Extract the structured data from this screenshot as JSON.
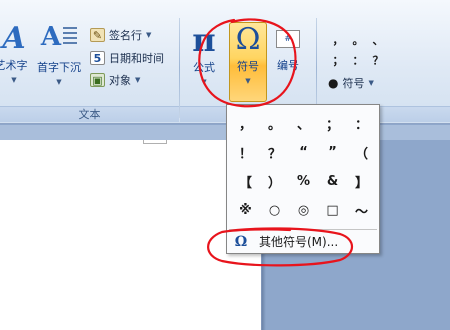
{
  "ribbon": {
    "text_group": {
      "label": "文本",
      "wordart_label": "艺术字",
      "dropcap_label": "首字下沉",
      "signature_label": "签名行",
      "datetime_label": "日期和时间",
      "object_label": "对象"
    },
    "symbols_group": {
      "equation_label": "公式",
      "symbol_label": "符号",
      "number_label": "编号"
    },
    "special_group": {
      "symbols": [
        "，",
        "。",
        "、",
        "；",
        "：",
        "？"
      ],
      "special_symbol_label": "符号"
    }
  },
  "symbol_dropdown": {
    "symbols": [
      "，",
      "。",
      "、",
      "；",
      "：",
      "！",
      "？",
      "“",
      "”",
      "（",
      "【",
      "）",
      "%",
      "&",
      "】",
      "※",
      "○",
      "◎",
      "□",
      "～"
    ],
    "more_symbols_label": "其他符号(M)..."
  },
  "colors": {
    "annotation": "#e8141c",
    "accent_orange": "#ffd561",
    "ribbon_text": "#15428b"
  }
}
